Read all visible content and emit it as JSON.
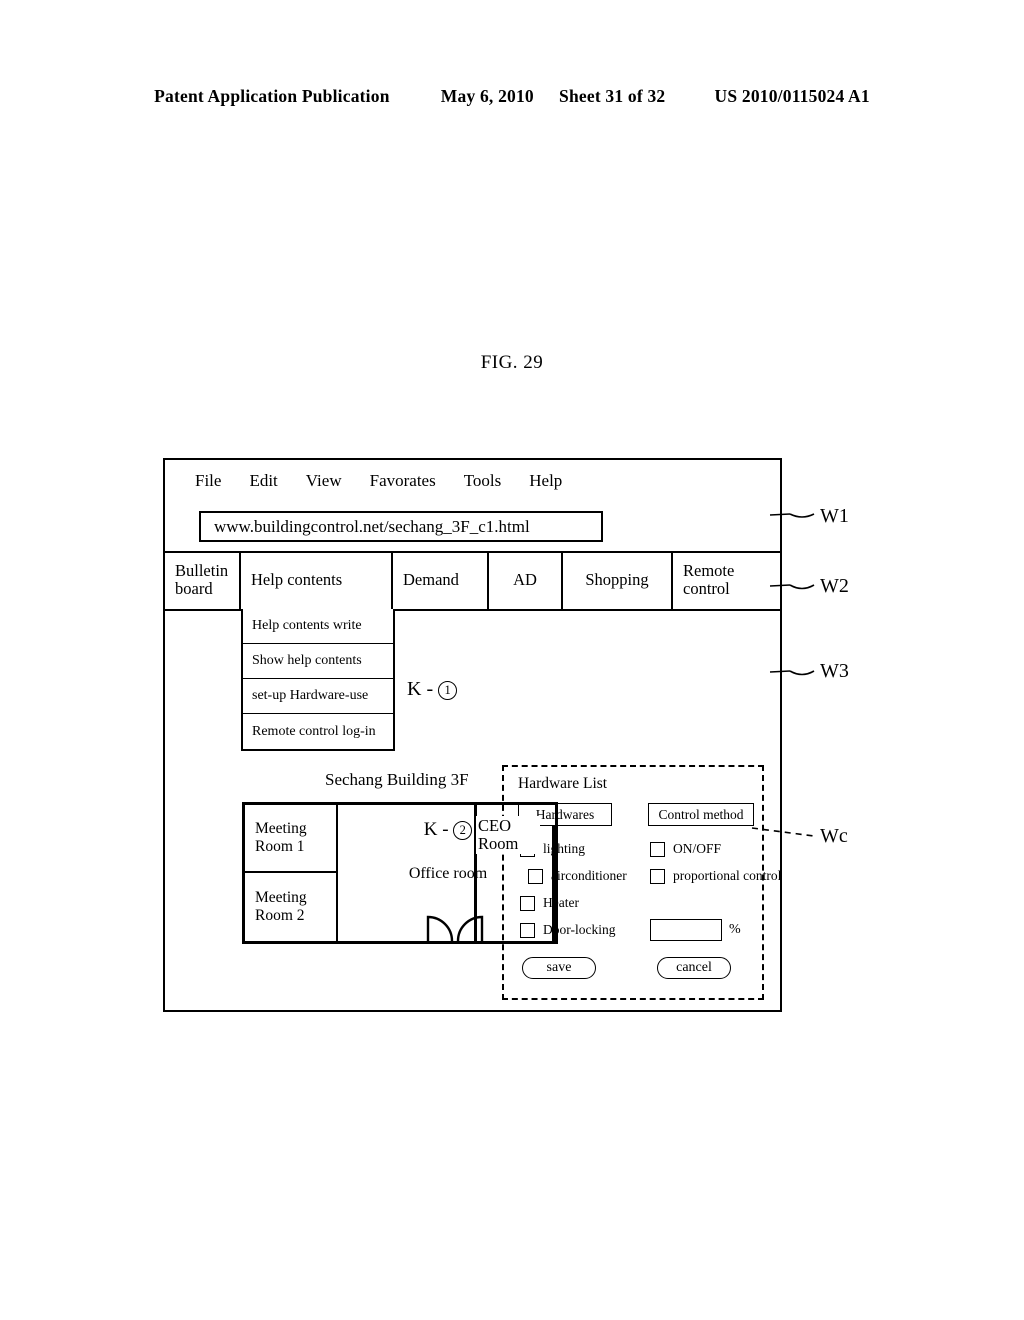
{
  "page_header": {
    "publication": "Patent Application Publication",
    "date": "May 6, 2010",
    "sheet": "Sheet 31 of 32",
    "pub_number": "US 2010/0115024 A1"
  },
  "figure": {
    "caption": "FIG. 29"
  },
  "browser": {
    "menu_items": [
      "File",
      "Edit",
      "View",
      "Favorates",
      "Tools",
      "Help"
    ],
    "url": "www.buildingcontrol.net/sechang_3F_c1.html",
    "tabs": [
      {
        "label": "Bulletin board"
      },
      {
        "label": "Help contents"
      },
      {
        "label": "Demand"
      },
      {
        "label": "AD"
      },
      {
        "label": "Shopping"
      },
      {
        "label": "Remote control"
      }
    ],
    "dropdown": {
      "items": [
        "Help contents write",
        "Show help contents",
        "set-up Hardware-use",
        "Remote control log-in"
      ]
    },
    "marker_k1": "K -",
    "marker_k1_num": "1"
  },
  "floorplan": {
    "title": "Sechang Building  3F",
    "meeting_room_1": "Meeting Room  1",
    "meeting_room_2": "Meeting Room  2",
    "marker_k2": "K -",
    "marker_k2_num": "2",
    "office_room": "Office room",
    "ceo_room": "CEO Room"
  },
  "dialog": {
    "title": "Hardware List",
    "hardwares_header": "Hardwares",
    "control_header": "Control method",
    "hardwares": [
      {
        "label": "lighting",
        "checked": false
      },
      {
        "label": "airconditioner",
        "checked": false
      },
      {
        "label": "Heater",
        "checked": false
      },
      {
        "label": "Door-locking",
        "checked": false
      }
    ],
    "control_methods": [
      {
        "label": "ON/OFF",
        "checked": false
      },
      {
        "label": "proportional control",
        "checked": false
      }
    ],
    "percent_value": "",
    "percent_sign": "%",
    "save_label": "save",
    "cancel_label": "cancel"
  },
  "callouts": {
    "w1": "W1",
    "w2": "W2",
    "w3": "W3",
    "wc": "Wc"
  }
}
